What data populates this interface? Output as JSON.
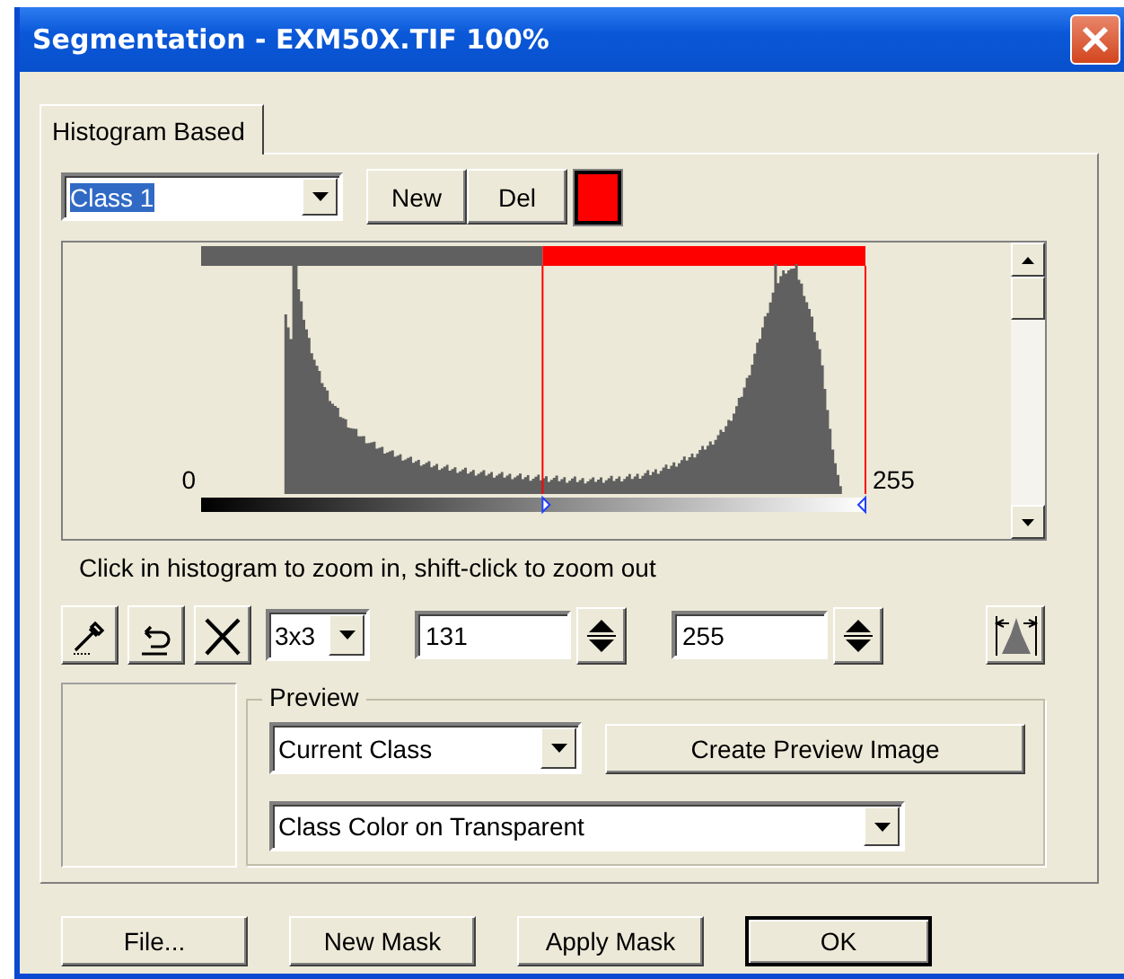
{
  "window": {
    "title": "Segmentation - EXM50X.TIF 100%"
  },
  "tabs": [
    {
      "label": "Histogram Based",
      "selected": true
    }
  ],
  "class_select": {
    "value": "Class 1",
    "highlighted": true,
    "color": "#ff0000"
  },
  "class_buttons": [
    "New",
    "Del"
  ],
  "histogram": {
    "min_label": "0",
    "max_label": "255",
    "lower_marker": {
      "level": 0.514
    },
    "upper_marker": {
      "level": 1.0
    }
  },
  "hint": "Click in histogram to zoom in, shift-click to zoom out",
  "tools": {
    "kernel": "3x3",
    "lower_value": "131",
    "upper_value": "255"
  },
  "preview": {
    "title": "Preview",
    "scope": "Current Class",
    "create_button": "Create Preview Image",
    "mode": "Class Color on Transparent"
  },
  "buttons": [
    {
      "label": "File...",
      "default": false
    },
    {
      "label": "New Mask",
      "default": false
    },
    {
      "label": "Apply Mask",
      "default": false
    },
    {
      "label": "OK",
      "default": true
    }
  ]
}
